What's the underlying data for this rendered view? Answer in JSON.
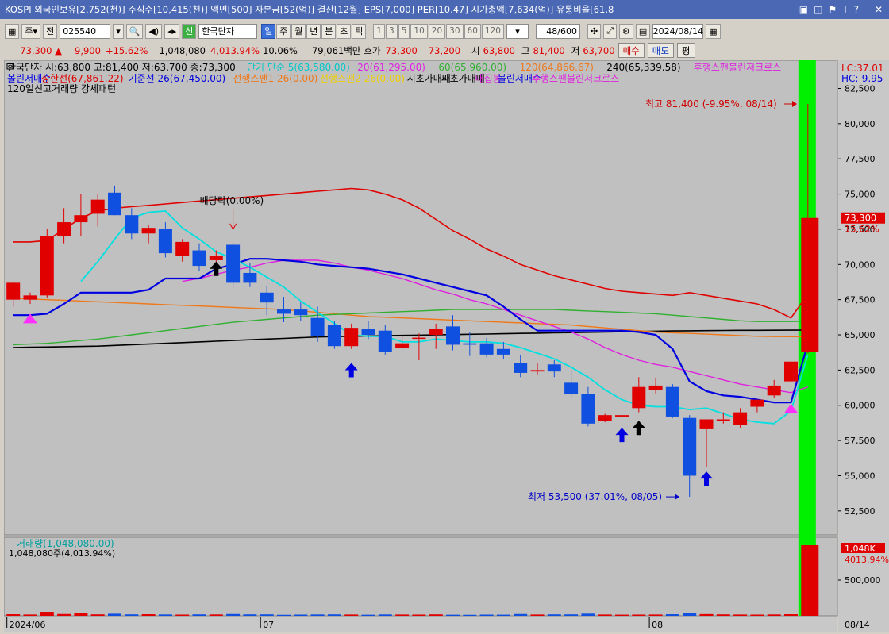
{
  "window": {
    "title": "KOSPI 외국인보유[2,752(천)] 주식수[10,415(천)] 액면[500] 자본금[52(억)] 결산[12월] EPS[7,000] PER[10.47] 시가총액[7,634(억)] 유통비율[61.8",
    "icons": [
      "restore-icon",
      "tile-icon",
      "pin-icon",
      "text-size-icon",
      "help-icon",
      "minimize-icon",
      "close-icon"
    ]
  },
  "toolbar": {
    "mode1": "주",
    "mode2": "전",
    "code": "025540",
    "badge": "신",
    "name": "한국단자",
    "periods": [
      "일",
      "주",
      "월",
      "년",
      "분",
      "초",
      "틱"
    ],
    "active_period": "일",
    "intervals": [
      "1",
      "3",
      "5",
      "10",
      "20",
      "30",
      "60",
      "120"
    ],
    "count": "48",
    "count_total": "/600",
    "date": "2024/08/14"
  },
  "quote": {
    "price": "73,300",
    "change": "9,900",
    "change_pct": "+15.62%",
    "volume": "1,048,080",
    "volume_pct": "4,013.94%",
    "turnover": "10.06%",
    "amount": "79,061백만",
    "hoga_label": "호가",
    "hoga1": "73,300",
    "hoga2": "73,200",
    "open_label": "시",
    "open": "63,800",
    "high_label": "고",
    "high": "81,400",
    "low_label": "저",
    "low": "63,700",
    "buy": "매수",
    "sell": "매도",
    "eval": "평"
  },
  "legend": {
    "line1": [
      {
        "text": "한국단자 시:63,800 고:81,400 저:63,700 종:73,300",
        "color": "#000000"
      },
      {
        "text": "단기 단순 5(63,580.00)",
        "color": "#00c8c8"
      },
      {
        "text": "20(61,295.00)",
        "color": "#e020e0"
      },
      {
        "text": "60(65,960.00)",
        "color": "#30b030"
      },
      {
        "text": "120(64,866.67)",
        "color": "#f07818"
      },
      {
        "text": "240(65,339.58)",
        "color": "#000000"
      },
      {
        "text": "후행스팬볼린저크로스",
        "color": "#e020e0"
      }
    ],
    "line2": [
      {
        "text": "볼린저매수",
        "color": "#0000e0"
      },
      {
        "text": "상한선(67,861.22)",
        "color": "#e00000"
      },
      {
        "text": "기준선 26(67,450.00)",
        "color": "#0000e0"
      },
      {
        "text": "선행스팬1 26(0.00)",
        "color": "#f07818"
      },
      {
        "text": "선행스팬2 26(0.00)",
        "color": "#f0d000"
      },
      {
        "text": "시초가매매",
        "color": "#000000"
      },
      {
        "text": "시초가매매",
        "color": "#000000"
      },
      {
        "text": "매집봉",
        "color": "#e020e0"
      },
      {
        "text": "볼린저매수",
        "color": "#0000e0"
      },
      {
        "text": "후행스팬볼린저크로스",
        "color": "#e020e0"
      }
    ],
    "line3": "120일신고거래량 강세패턴",
    "lc": "LC:37.01",
    "hc": "HC:-9.95",
    "dividend": "배당락(0.00%)",
    "high_note": "최고 81,400 (-9.95%, 08/14)",
    "low_note": "최저 53,500 (37.01%, 08/05)",
    "price_tag": "73,300",
    "price_tag_pct": "15.62%"
  },
  "volume_panel": {
    "title": "거래량(1,048,080.00)",
    "subtitle": "1,048,080주(4,013.94%)",
    "tag": "1,048K",
    "tag_pct": "4013.94%",
    "axis_label": "500,000"
  },
  "xaxis": {
    "labels": [
      {
        "text": "2024/06",
        "index": 0
      },
      {
        "text": "07",
        "index": 15
      },
      {
        "text": "08",
        "index": 38
      }
    ],
    "right_label": "08/14"
  },
  "chart_data": {
    "type": "candlestick",
    "ylim": [
      50800,
      84500
    ],
    "yticks": [
      52500,
      55000,
      57500,
      60000,
      62500,
      65000,
      67500,
      70000,
      72500,
      75000,
      77500,
      80000,
      82500
    ],
    "candles": [
      {
        "o": 67500,
        "h": 68800,
        "l": 67000,
        "c": 68700
      },
      {
        "o": 67500,
        "h": 68000,
        "l": 67200,
        "c": 67800
      },
      {
        "o": 67800,
        "h": 72500,
        "l": 67600,
        "c": 72000
      },
      {
        "o": 72000,
        "h": 74000,
        "l": 71500,
        "c": 73000
      },
      {
        "o": 73000,
        "h": 75000,
        "l": 72000,
        "c": 73500
      },
      {
        "o": 73600,
        "h": 75000,
        "l": 72700,
        "c": 74600
      },
      {
        "o": 75100,
        "h": 75600,
        "l": 73500,
        "c": 73500
      },
      {
        "o": 73500,
        "h": 74000,
        "l": 71800,
        "c": 72200
      },
      {
        "o": 72200,
        "h": 72800,
        "l": 71500,
        "c": 72600
      },
      {
        "o": 72500,
        "h": 73000,
        "l": 70500,
        "c": 70800
      },
      {
        "o": 70600,
        "h": 71800,
        "l": 70200,
        "c": 71600
      },
      {
        "o": 71000,
        "h": 71500,
        "l": 69500,
        "c": 69900
      },
      {
        "o": 70300,
        "h": 71000,
        "l": 69900,
        "c": 70600
      },
      {
        "o": 71400,
        "h": 71600,
        "l": 68300,
        "c": 68700
      },
      {
        "o": 69400,
        "h": 70100,
        "l": 68400,
        "c": 68700
      },
      {
        "o": 68000,
        "h": 68500,
        "l": 66400,
        "c": 67300
      },
      {
        "o": 66800,
        "h": 67700,
        "l": 65900,
        "c": 66500
      },
      {
        "o": 66800,
        "h": 67300,
        "l": 66000,
        "c": 66400
      },
      {
        "o": 66200,
        "h": 67000,
        "l": 64500,
        "c": 64900
      },
      {
        "o": 65700,
        "h": 66000,
        "l": 64000,
        "c": 64200
      },
      {
        "o": 64200,
        "h": 65800,
        "l": 64000,
        "c": 65500
      },
      {
        "o": 65400,
        "h": 66000,
        "l": 64700,
        "c": 65000
      },
      {
        "o": 65300,
        "h": 65700,
        "l": 63600,
        "c": 63800
      },
      {
        "o": 64100,
        "h": 64900,
        "l": 63900,
        "c": 64400
      },
      {
        "o": 64800,
        "h": 65100,
        "l": 63200,
        "c": 64800
      },
      {
        "o": 65000,
        "h": 65800,
        "l": 64000,
        "c": 65400
      },
      {
        "o": 65600,
        "h": 66400,
        "l": 63900,
        "c": 64300
      },
      {
        "o": 64400,
        "h": 65200,
        "l": 63500,
        "c": 64300
      },
      {
        "o": 64400,
        "h": 64800,
        "l": 63400,
        "c": 63600
      },
      {
        "o": 64000,
        "h": 64500,
        "l": 63300,
        "c": 63600
      },
      {
        "o": 63000,
        "h": 63600,
        "l": 62000,
        "c": 62300
      },
      {
        "o": 62400,
        "h": 63000,
        "l": 62200,
        "c": 62500
      },
      {
        "o": 62900,
        "h": 63200,
        "l": 62000,
        "c": 62400
      },
      {
        "o": 61600,
        "h": 62400,
        "l": 60500,
        "c": 60800
      },
      {
        "o": 60800,
        "h": 61300,
        "l": 58500,
        "c": 58700
      },
      {
        "o": 58900,
        "h": 59400,
        "l": 58800,
        "c": 59300
      },
      {
        "o": 59200,
        "h": 60500,
        "l": 58800,
        "c": 59300
      },
      {
        "o": 59800,
        "h": 62000,
        "l": 59500,
        "c": 61300
      },
      {
        "o": 61100,
        "h": 61900,
        "l": 60800,
        "c": 61400
      },
      {
        "o": 61300,
        "h": 61500,
        "l": 59100,
        "c": 59200
      },
      {
        "o": 59100,
        "h": 59300,
        "l": 53500,
        "c": 55000
      },
      {
        "o": 58300,
        "h": 59000,
        "l": 55600,
        "c": 59000
      },
      {
        "o": 59000,
        "h": 59500,
        "l": 58700,
        "c": 59000
      },
      {
        "o": 58600,
        "h": 59800,
        "l": 58400,
        "c": 59500
      },
      {
        "o": 59900,
        "h": 60400,
        "l": 59500,
        "c": 60400
      },
      {
        "o": 60700,
        "h": 61800,
        "l": 60500,
        "c": 61400
      },
      {
        "o": 61700,
        "h": 64000,
        "l": 61600,
        "c": 63100
      },
      {
        "o": 63800,
        "h": 81400,
        "l": 63700,
        "c": 73300
      }
    ],
    "volume": [
      22000,
      18000,
      55000,
      25000,
      36000,
      20000,
      29000,
      20000,
      22000,
      19000,
      17000,
      20000,
      19000,
      25000,
      20000,
      20000,
      14000,
      17000,
      19000,
      20000,
      18000,
      15000,
      19000,
      18000,
      17000,
      20000,
      15000,
      14000,
      17000,
      16000,
      25000,
      18000,
      20000,
      20000,
      30000,
      18000,
      16000,
      17000,
      18000,
      22000,
      34000,
      24000,
      20000,
      18000,
      17000,
      19000,
      22000,
      1048080
    ],
    "volume_ylim": [
      0,
      1100000
    ],
    "ma5": [
      null,
      null,
      null,
      null,
      68800,
      70200,
      71800,
      73300,
      73700,
      73800,
      72600,
      71800,
      70900,
      70400,
      69800,
      69100,
      68400,
      67400,
      66600,
      65800,
      65000,
      64900,
      64900,
      64500,
      64500,
      64700,
      64600,
      64500,
      64500,
      64400,
      64100,
      63700,
      63300,
      62700,
      62000,
      61100,
      60400,
      60000,
      59900,
      59900,
      59700,
      59800,
      59400,
      59000,
      58800,
      58700,
      59600,
      63600
    ],
    "ma20": [
      null,
      null,
      null,
      null,
      null,
      null,
      null,
      null,
      null,
      null,
      68800,
      69000,
      69300,
      69600,
      69800,
      70100,
      70300,
      70300,
      70300,
      70100,
      69800,
      69600,
      69300,
      69000,
      68600,
      68200,
      67900,
      67500,
      67200,
      66800,
      66400,
      66000,
      65600,
      65200,
      64700,
      64100,
      63600,
      63200,
      62900,
      62700,
      62400,
      62100,
      61800,
      61500,
      61300,
      61100,
      60900,
      61300
    ],
    "ma60": [
      64300,
      64350,
      64400,
      64500,
      64600,
      64700,
      64850,
      65000,
      65150,
      65300,
      65450,
      65600,
      65750,
      65900,
      66000,
      66100,
      66200,
      66300,
      66400,
      66450,
      66500,
      66550,
      66600,
      66650,
      66700,
      66750,
      66800,
      66800,
      66800,
      66800,
      66800,
      66800,
      66800,
      66750,
      66700,
      66650,
      66600,
      66550,
      66500,
      66400,
      66300,
      66200,
      66100,
      66000,
      65950,
      65950,
      65950,
      65960
    ],
    "ma120": [
      67600,
      67550,
      67500,
      67450,
      67400,
      67350,
      67300,
      67250,
      67200,
      67150,
      67100,
      67050,
      67000,
      66950,
      66900,
      66850,
      66800,
      66700,
      66600,
      66500,
      66400,
      66300,
      66250,
      66200,
      66150,
      66100,
      66050,
      66000,
      65950,
      65900,
      65850,
      65800,
      65750,
      65700,
      65600,
      65500,
      65400,
      65300,
      65200,
      65150,
      65100,
      65050,
      65000,
      64950,
      64900,
      64880,
      64870,
      64866
    ],
    "ma240": [
      64100,
      64120,
      64140,
      64160,
      64180,
      64200,
      64250,
      64300,
      64350,
      64400,
      64450,
      64500,
      64550,
      64600,
      64650,
      64700,
      64750,
      64800,
      64850,
      64880,
      64900,
      64920,
      64940,
      64960,
      64980,
      65000,
      65020,
      65040,
      65060,
      65080,
      65100,
      65120,
      65140,
      65160,
      65180,
      65200,
      65220,
      65240,
      65260,
      65280,
      65290,
      65300,
      65310,
      65320,
      65325,
      65330,
      65335,
      65340
    ],
    "bb_upper": [
      71600,
      71600,
      71700,
      72500,
      73300,
      73800,
      74000,
      74100,
      74200,
      74300,
      74400,
      74500,
      74600,
      74700,
      74800,
      74900,
      75000,
      75100,
      75200,
      75300,
      75400,
      75300,
      75000,
      74600,
      74000,
      73200,
      72400,
      71800,
      71100,
      70600,
      70000,
      69600,
      69200,
      68900,
      68600,
      68300,
      68100,
      68000,
      67900,
      67800,
      68000,
      67800,
      67600,
      67400,
      67200,
      66800,
      66200,
      67900
    ],
    "kijun": [
      66400,
      66400,
      66500,
      67200,
      68000,
      68000,
      68000,
      68000,
      68200,
      69000,
      69000,
      69000,
      69700,
      70000,
      70400,
      70400,
      70300,
      70200,
      70000,
      69900,
      69800,
      69700,
      69500,
      69300,
      69000,
      68700,
      68400,
      68100,
      67800,
      67000,
      66100,
      65300,
      65300,
      65300,
      65300,
      65300,
      65300,
      65200,
      65000,
      64000,
      61700,
      61000,
      60700,
      60600,
      60400,
      60200,
      60200,
      64400
    ]
  }
}
